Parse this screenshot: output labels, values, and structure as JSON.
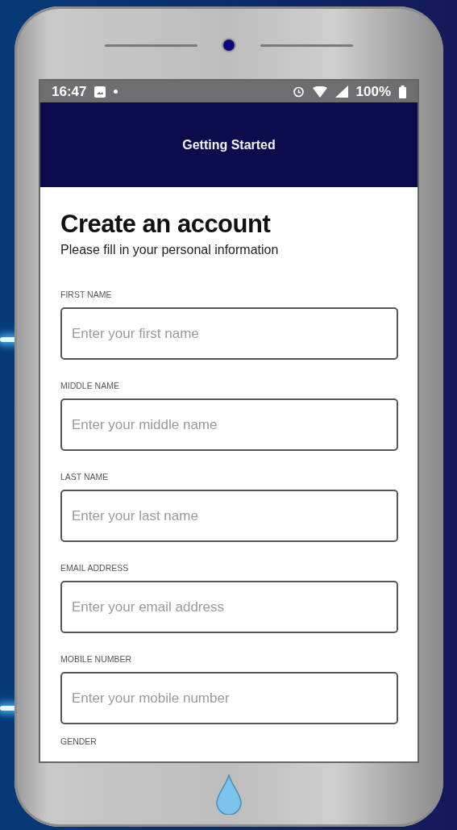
{
  "status_bar": {
    "time": "16:47",
    "battery": "100%"
  },
  "app_bar": {
    "title": "Getting Started"
  },
  "form": {
    "title": "Create an account",
    "subtitle": "Please fill in your personal information",
    "fields": [
      {
        "label": "FIRST NAME",
        "placeholder": "Enter your first name"
      },
      {
        "label": "MIDDLE NAME",
        "placeholder": "Enter your middle name"
      },
      {
        "label": "LAST NAME",
        "placeholder": "Enter your last name"
      },
      {
        "label": "EMAIL ADDRESS",
        "placeholder": "Enter your email address"
      },
      {
        "label": "MOBILE NUMBER",
        "placeholder": "Enter your mobile number"
      }
    ],
    "next_label": "GENDER"
  }
}
